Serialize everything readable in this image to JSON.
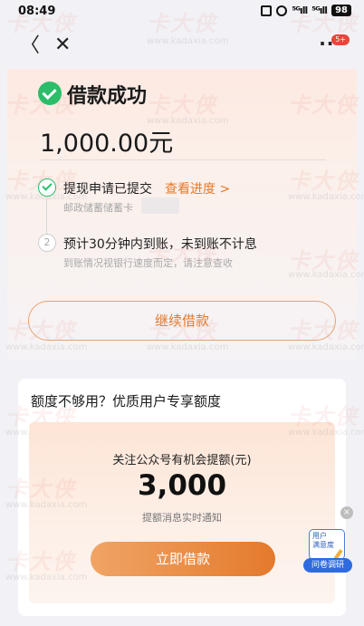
{
  "status_bar": {
    "time": "08:49",
    "signal_1": "⁵ᴳıll",
    "signal_2": "⁵ᴳıll",
    "battery": "98"
  },
  "nav": {
    "back_glyph": "〈",
    "close_glyph": "✕",
    "more_glyph": "···",
    "badge": "5+"
  },
  "result": {
    "title": "借款成功",
    "amount": "1,000.00元",
    "icon": "check-circle-icon",
    "icon_color": "#2bbd6a"
  },
  "steps": [
    {
      "text": "提现申请已提交",
      "link": "查看进度 >",
      "sub": "邮政储蓄储蓄卡"
    },
    {
      "index": "2",
      "text": "预计30分钟内到账，未到账不计息",
      "sub": "到账情况视银行速度而定，请注意查收"
    }
  ],
  "continue_button": "继续借款",
  "promo": {
    "title": "额度不够用？优质用户专享额度",
    "subtitle": "关注公众号有机会提额(元)",
    "amount": "3,000",
    "notify": "提额消息实时通知",
    "button": "立即借款"
  },
  "survey_widget": {
    "close_glyph": "×",
    "box_line1": "用户",
    "box_line2": "满意度",
    "label": "问卷调研"
  },
  "watermark": {
    "brand": "卡大侠",
    "url": "www.kadaxia.com"
  },
  "colors": {
    "accent": "#e47a2c",
    "success": "#2bbd6a",
    "survey_blue": "#2f6be0"
  }
}
